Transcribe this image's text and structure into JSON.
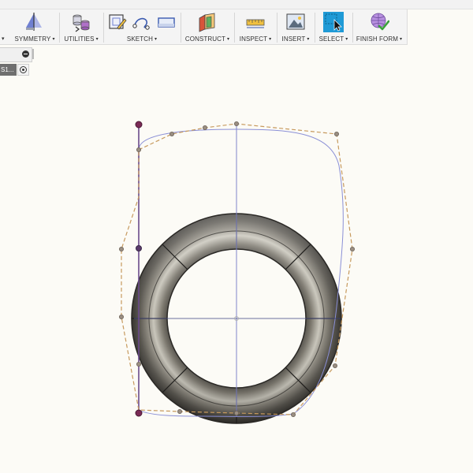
{
  "window": {
    "app": "Fusion 360 - Sculpt / Form workspace"
  },
  "toolbar": {
    "groups": [
      {
        "id": "symmetry",
        "label": "SYMMETRY",
        "icon": "symmetry-icon"
      },
      {
        "id": "utilities",
        "label": "UTILITIES",
        "icon": "utilities-icon"
      },
      {
        "id": "sketch",
        "label": "SKETCH",
        "icon": "sketch-icon"
      },
      {
        "id": "construct",
        "label": "CONSTRUCT",
        "icon": "construct-plane-icon"
      },
      {
        "id": "inspect",
        "label": "INSPECT",
        "icon": "measure-icon"
      },
      {
        "id": "insert",
        "label": "INSERT",
        "icon": "insert-image-icon"
      },
      {
        "id": "select",
        "label": "SELECT",
        "icon": "select-cursor-icon"
      },
      {
        "id": "finish_form",
        "label": "FINISH FORM",
        "icon": "finish-form-icon"
      }
    ],
    "dropdown_arrow": "▾"
  },
  "browser": {
    "selected_item_label": "S1...",
    "collapse_icon": "minus-circle-icon",
    "visibility_icon": "radio-target-icon"
  },
  "viewport": {
    "object": "torus ring (T-spline form body)",
    "spline_color": "#8a8fd6",
    "control_polygon_color": "#c79a5e",
    "axis_line_color": "#7f85c9",
    "ring_color": "#6e6a60"
  }
}
